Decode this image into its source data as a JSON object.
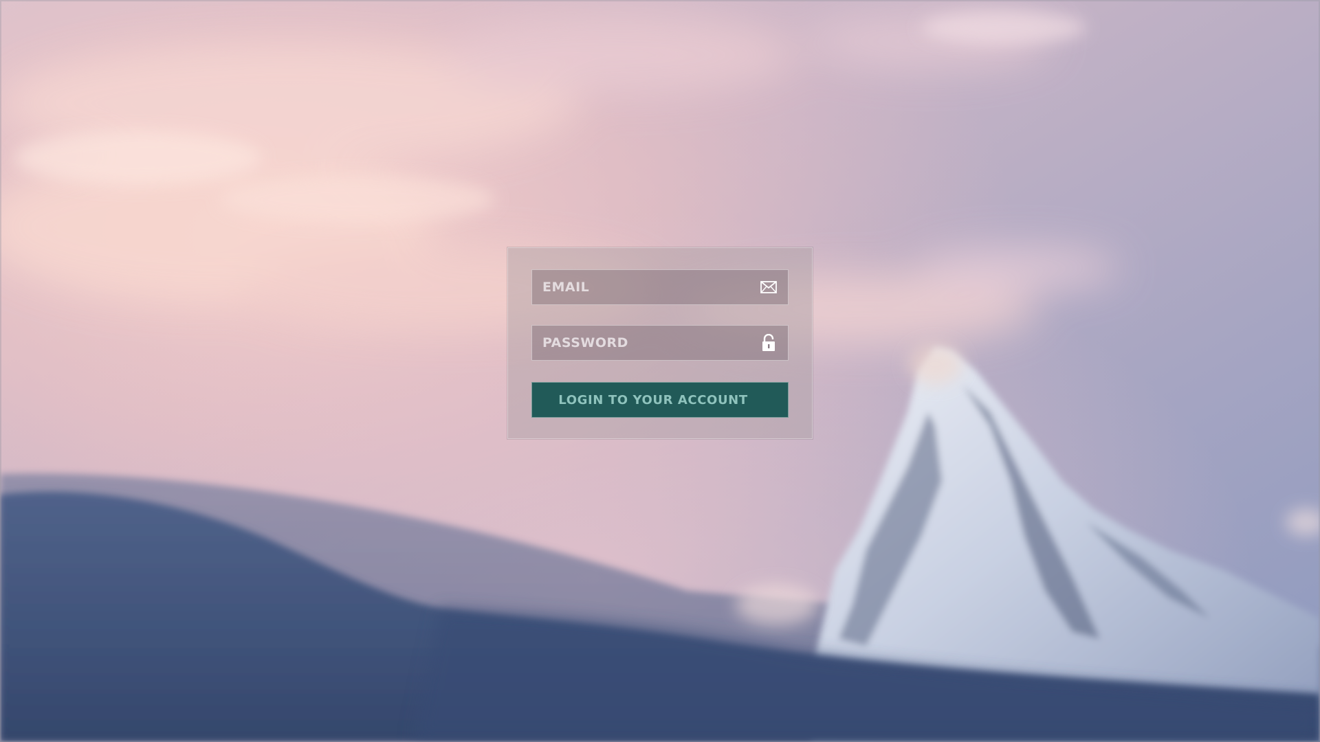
{
  "login": {
    "email_placeholder": "EMAIL",
    "password_placeholder": "PASSWORD",
    "button_label": "LOGIN TO YOUR ACCOUNT"
  },
  "icons": {
    "email": "envelope-icon",
    "password": "lock-icon"
  },
  "colors": {
    "button": "#215a58",
    "button_text": "#8fc3bd",
    "sky_top": "#c9b6c8",
    "sky_pink": "#f3c9c6",
    "sky_blue": "#8f9cbf",
    "snow_hill": "#42577f"
  }
}
